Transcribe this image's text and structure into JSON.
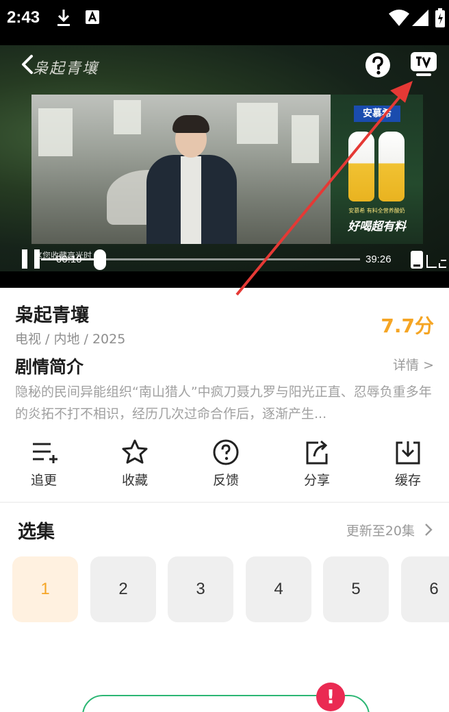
{
  "status_bar": {
    "time": "2:43",
    "icons": [
      "download-icon",
      "notification-app-icon",
      "wifi-icon",
      "cellular-signal-icon",
      "battery-charging-icon"
    ]
  },
  "player": {
    "title_art": "枭起青壤",
    "ad": {
      "brand": "安慕希",
      "subline": "安慕希 有料全营养酸奶",
      "slogan": "好喝超有料"
    },
    "danmu_text": "这您收藏高光时",
    "current_time": "00:10",
    "total_time": "39:26",
    "progress": 0.004,
    "icons": [
      "back-icon",
      "help-icon",
      "tv-cast-icon",
      "pause-icon",
      "fullscreen-icon"
    ]
  },
  "show": {
    "title": "枭起青壤",
    "meta": "电视 / 内地 / 2025",
    "score": "7.7分"
  },
  "synopsis": {
    "heading": "剧情简介",
    "detail_link": "详情 >",
    "text": "隐秘的民间异能组织“南山猎人”中疯刀聂九罗与阳光正直、忍辱负重多年的炎拓不打不相识，经历几次过命合作后，逐渐产生..."
  },
  "actions": [
    {
      "label": "追更",
      "icon": "add-to-list-icon"
    },
    {
      "label": "收藏",
      "icon": "star-icon"
    },
    {
      "label": "反馈",
      "icon": "question-icon"
    },
    {
      "label": "分享",
      "icon": "share-icon"
    },
    {
      "label": "缓存",
      "icon": "download-box-icon"
    }
  ],
  "episodes": {
    "heading": "选集",
    "update_status": "更新至20集",
    "items": [
      "1",
      "2",
      "3",
      "4",
      "5",
      "6"
    ],
    "selected": "1"
  },
  "colors": {
    "accent": "#f5a524",
    "annotation_arrow": "#e53935",
    "alert": "#ea2a52",
    "pill_border": "#2bb673"
  },
  "bottom": {
    "alert_mark": "!"
  }
}
